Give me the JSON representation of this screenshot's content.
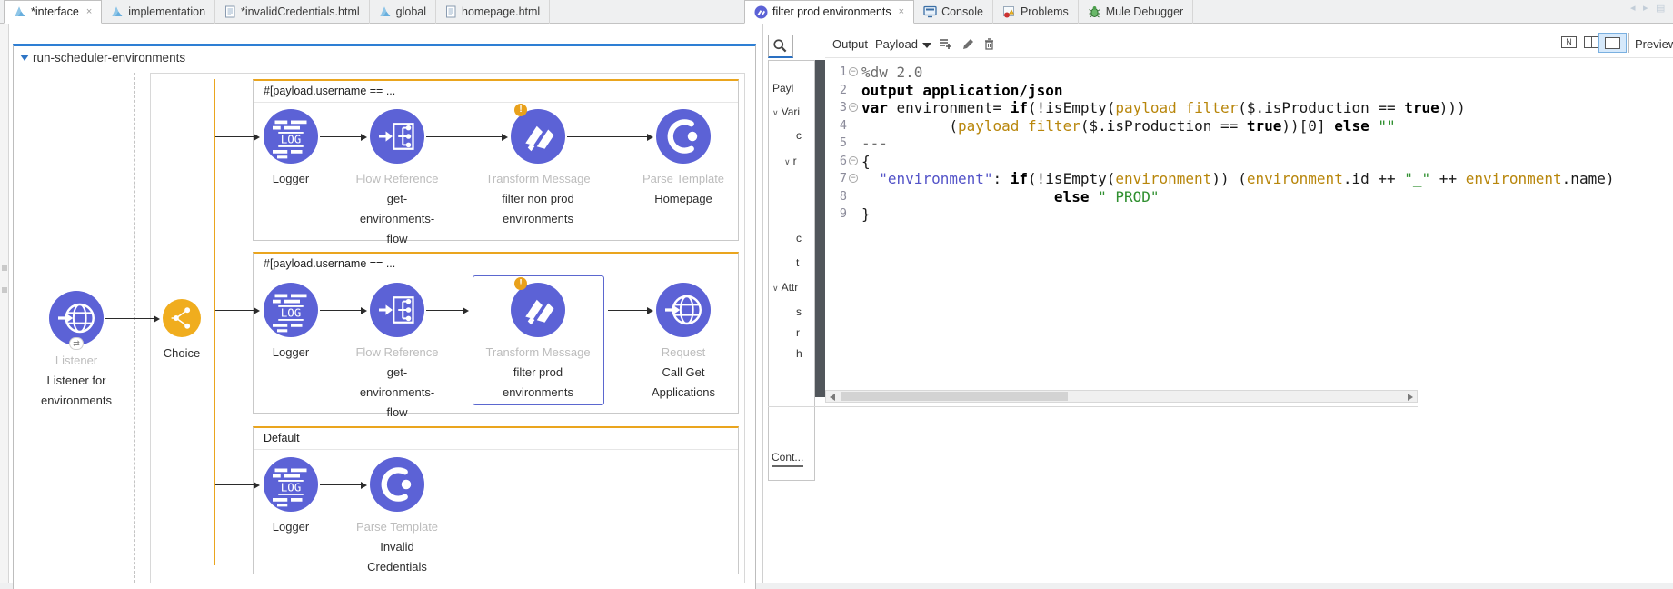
{
  "tabs_left": [
    {
      "label": "*interface",
      "icon": "mule-icon",
      "active": true,
      "closable": true
    },
    {
      "label": "implementation",
      "icon": "mule-icon",
      "active": false,
      "closable": false
    },
    {
      "label": "*invalidCredentials.html",
      "icon": "html-file-icon",
      "active": false,
      "closable": false
    },
    {
      "label": "global",
      "icon": "mule-icon",
      "active": false,
      "closable": false
    },
    {
      "label": "homepage.html",
      "icon": "html-file-icon",
      "active": false,
      "closable": false
    }
  ],
  "tabs_right": [
    {
      "label": "filter prod environments",
      "icon": "dataweave-icon",
      "active": true,
      "closable": true
    },
    {
      "label": "Console",
      "icon": "console-icon",
      "active": false,
      "closable": false
    },
    {
      "label": "Problems",
      "icon": "problems-icon",
      "active": false,
      "closable": false
    },
    {
      "label": "Mule Debugger",
      "icon": "bug-icon",
      "active": false,
      "closable": false
    }
  ],
  "flow": {
    "title": "run-scheduler-environments",
    "source": {
      "icon": "http-listener",
      "type_label": "Listener",
      "name_lines": [
        "Listener for",
        "environments"
      ]
    },
    "router": {
      "icon": "choice",
      "label": "Choice"
    },
    "branches": [
      {
        "header": "#[payload.username == ...",
        "components": [
          {
            "icon": "logger",
            "type_label": "Logger",
            "type_dark": true,
            "name_lines": []
          },
          {
            "icon": "flow-ref",
            "type_label": "Flow Reference",
            "name_lines": [
              "get-",
              "environments-",
              "flow"
            ]
          },
          {
            "icon": "transform",
            "type_label": "Transform Message",
            "name_lines": [
              "filter non prod",
              "environments"
            ],
            "warning": true
          },
          {
            "icon": "parse-template",
            "type_label": "Parse Template",
            "name_lines": [
              "Homepage"
            ]
          }
        ]
      },
      {
        "header": "#[payload.username == ...",
        "components": [
          {
            "icon": "logger",
            "type_label": "Logger",
            "type_dark": true,
            "name_lines": []
          },
          {
            "icon": "flow-ref",
            "type_label": "Flow Reference",
            "name_lines": [
              "get-",
              "environments-",
              "flow"
            ]
          },
          {
            "icon": "transform",
            "type_label": "Transform Message",
            "name_lines": [
              "filter prod",
              "environments"
            ],
            "warning": true,
            "selected": true
          },
          {
            "icon": "http-request",
            "type_label": "Request",
            "name_lines": [
              "Call Get",
              "Applications"
            ]
          }
        ]
      },
      {
        "header": "Default",
        "components": [
          {
            "icon": "logger",
            "type_label": "Logger",
            "type_dark": true,
            "name_lines": []
          },
          {
            "icon": "parse-template",
            "type_label": "Parse Template",
            "name_lines": [
              "Invalid",
              "Credentials"
            ]
          }
        ]
      }
    ]
  },
  "dw": {
    "toolbar": {
      "output": "Output",
      "payload": "Payload",
      "preview": "Preview"
    },
    "tree": {
      "items": [
        {
          "label": "Payl",
          "chevron": false,
          "indent": 0
        },
        {
          "label": "Vari",
          "chevron": true,
          "indent": 0
        },
        {
          "label": "c",
          "chevron": false,
          "indent": 2
        },
        {
          "label": "r",
          "chevron": true,
          "indent": 1
        },
        {
          "label": "c",
          "chevron": false,
          "indent": 2
        },
        {
          "label": "t",
          "chevron": false,
          "indent": 2
        },
        {
          "label": "Attr",
          "chevron": true,
          "indent": 0
        },
        {
          "label": "s",
          "chevron": false,
          "indent": 2
        },
        {
          "label": "r",
          "chevron": false,
          "indent": 2
        },
        {
          "label": "h",
          "chevron": false,
          "indent": 2
        }
      ],
      "bottom_tab": "Cont..."
    },
    "code": {
      "lines": [
        {
          "n": "1",
          "fold": true,
          "tokens": [
            [
              "c",
              "%dw 2.0"
            ]
          ]
        },
        {
          "n": "2",
          "fold": false,
          "tokens": [
            [
              "k",
              "output application/json"
            ]
          ]
        },
        {
          "n": "3",
          "fold": true,
          "tokens": [
            [
              "k",
              "var"
            ],
            [
              "p",
              " environment= "
            ],
            [
              "k",
              "if"
            ],
            [
              "p",
              "(!isEmpty("
            ],
            [
              "o",
              "payload"
            ],
            [
              "p",
              " "
            ],
            [
              "o",
              "filter"
            ],
            [
              "p",
              "($.isProduction == "
            ],
            [
              "k",
              "true"
            ],
            [
              "p",
              ")))"
            ]
          ]
        },
        {
          "n": "4",
          "fold": false,
          "tokens": [
            [
              "p",
              "          ("
            ],
            [
              "o",
              "payload"
            ],
            [
              "p",
              " "
            ],
            [
              "o",
              "filter"
            ],
            [
              "p",
              "($.isProduction == "
            ],
            [
              "k",
              "true"
            ],
            [
              "p",
              "))[0] "
            ],
            [
              "k",
              "else"
            ],
            [
              "p",
              " "
            ],
            [
              "s",
              "\"\""
            ]
          ]
        },
        {
          "n": "5",
          "fold": false,
          "tokens": [
            [
              "c",
              "---"
            ]
          ]
        },
        {
          "n": "6",
          "fold": true,
          "tokens": [
            [
              "p",
              "{"
            ]
          ]
        },
        {
          "n": "7",
          "fold": true,
          "tokens": [
            [
              "p",
              "  "
            ],
            [
              "key",
              "\"environment\""
            ],
            [
              "p",
              ": "
            ],
            [
              "k",
              "if"
            ],
            [
              "p",
              "(!isEmpty("
            ],
            [
              "o",
              "environment"
            ],
            [
              "p",
              ")) ("
            ],
            [
              "o",
              "environment"
            ],
            [
              "p",
              ".id ++ "
            ],
            [
              "s",
              "\"_\""
            ],
            [
              "p",
              " ++ "
            ],
            [
              "o",
              "environment"
            ],
            [
              "p",
              ".name)"
            ]
          ]
        },
        {
          "n": "8",
          "fold": false,
          "tokens": [
            [
              "p",
              "                      "
            ],
            [
              "k",
              "else"
            ],
            [
              "p",
              " "
            ],
            [
              "s",
              "\"_PROD\""
            ]
          ]
        },
        {
          "n": "9",
          "fold": false,
          "tokens": [
            [
              "p",
              "}"
            ]
          ]
        }
      ]
    }
  },
  "colors": {
    "accent_blue": "#2e7fd4",
    "orange": "#eaa51e",
    "component_blue": "#5c62d6",
    "selection": "#5b67cf",
    "warning": "#e9a11b",
    "choice_orange": "#f0ad1e",
    "string_green": "#2f8f2f",
    "ident_gold": "#b8860b",
    "key_violet": "#5353c8"
  }
}
